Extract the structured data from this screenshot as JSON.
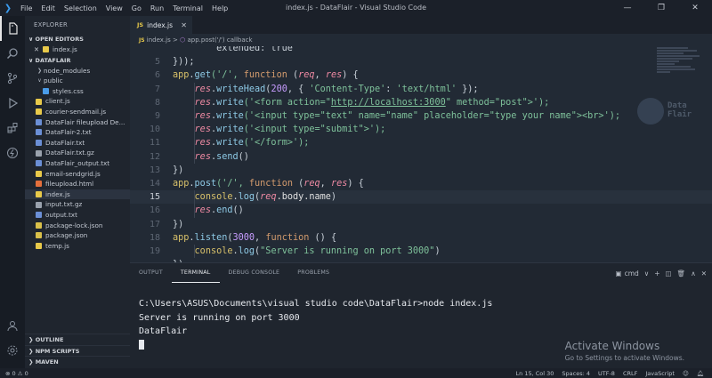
{
  "window": {
    "title": "index.js - DataFlair - Visual Studio Code",
    "menu": [
      "File",
      "Edit",
      "Selection",
      "View",
      "Go",
      "Run",
      "Terminal",
      "Help"
    ],
    "controls": [
      "—",
      "❐",
      "✕"
    ]
  },
  "activity": [
    "files-icon",
    "search-icon",
    "source-control-icon",
    "run-debug-icon",
    "extensions-icon",
    "remote-icon"
  ],
  "sidebar": {
    "header": "EXPLORER",
    "open_editors_label": "OPEN EDITORS",
    "open_editor_file": "index.js",
    "folder_label": "DATAFLAIR",
    "items": [
      {
        "label": "node_modules",
        "type": "folder",
        "indent": 1
      },
      {
        "label": "public",
        "type": "folder-open",
        "indent": 1
      },
      {
        "label": "styles.css",
        "type": "css",
        "indent": 2
      },
      {
        "label": "client.js",
        "type": "js",
        "indent": 1
      },
      {
        "label": "courier-sendmail.js",
        "type": "js",
        "indent": 1
      },
      {
        "label": "DataFlair fileupload De...",
        "type": "txt",
        "indent": 1
      },
      {
        "label": "DataFlair-2.txt",
        "type": "txt",
        "indent": 1
      },
      {
        "label": "DataFlair.txt",
        "type": "txt",
        "indent": 1
      },
      {
        "label": "DataFlair.txt.gz",
        "type": "gz",
        "indent": 1
      },
      {
        "label": "DataFlair_output.txt",
        "type": "txt",
        "indent": 1
      },
      {
        "label": "email-sendgrid.js",
        "type": "js",
        "indent": 1
      },
      {
        "label": "fileupload.html",
        "type": "html",
        "indent": 1
      },
      {
        "label": "index.js",
        "type": "js",
        "indent": 1,
        "selected": true
      },
      {
        "label": "input.txt.gz",
        "type": "gz",
        "indent": 1
      },
      {
        "label": "output.txt",
        "type": "txt",
        "indent": 1
      },
      {
        "label": "package-lock.json",
        "type": "json",
        "indent": 1
      },
      {
        "label": "package.json",
        "type": "json",
        "indent": 1
      },
      {
        "label": "temp.js",
        "type": "js",
        "indent": 1
      }
    ],
    "bottom_sections": [
      "OUTLINE",
      "NPM SCRIPTS",
      "MAVEN"
    ]
  },
  "editor": {
    "tab_label": "index.js",
    "tab_icon": "JS",
    "breadcrumb": {
      "file": "index.js",
      "separator": ">",
      "symbol": "app.post('/') callback"
    },
    "lines": [
      {
        "n": "",
        "tokens": [
          {
            "t": "        extended: true",
            "c": "t-p"
          }
        ],
        "partial": true
      },
      {
        "n": "5",
        "tokens": [
          {
            "t": "}));",
            "c": "t-p"
          }
        ]
      },
      {
        "n": "6",
        "tokens": [
          {
            "t": "app",
            "c": "t-obj"
          },
          {
            "t": ".",
            "c": "t-p"
          },
          {
            "t": "get",
            "c": "t-call"
          },
          {
            "t": "('/', ",
            "c": "t-str"
          },
          {
            "t": "function",
            "c": "t-kw"
          },
          {
            "t": " (",
            "c": "t-p"
          },
          {
            "t": "req",
            "c": "t-var"
          },
          {
            "t": ", ",
            "c": "t-p"
          },
          {
            "t": "res",
            "c": "t-var"
          },
          {
            "t": ") {",
            "c": "t-p"
          }
        ]
      },
      {
        "n": "7",
        "tokens": [
          {
            "t": "    ",
            "c": "t-p"
          },
          {
            "t": "res",
            "c": "t-var"
          },
          {
            "t": ".",
            "c": "t-p"
          },
          {
            "t": "writeHead",
            "c": "t-call"
          },
          {
            "t": "(",
            "c": "t-p"
          },
          {
            "t": "200",
            "c": "t-num"
          },
          {
            "t": ", { ",
            "c": "t-p"
          },
          {
            "t": "'Content-Type'",
            "c": "t-str"
          },
          {
            "t": ": ",
            "c": "t-p"
          },
          {
            "t": "'text/html'",
            "c": "t-str"
          },
          {
            "t": " });",
            "c": "t-p"
          }
        ]
      },
      {
        "n": "8",
        "tokens": [
          {
            "t": "    ",
            "c": "t-p"
          },
          {
            "t": "res",
            "c": "t-var"
          },
          {
            "t": ".",
            "c": "t-p"
          },
          {
            "t": "write",
            "c": "t-call"
          },
          {
            "t": "('<form action=\"",
            "c": "t-str"
          },
          {
            "t": "http://localhost:3000",
            "c": "t-url"
          },
          {
            "t": "\" method=\"post\">');",
            "c": "t-str"
          }
        ]
      },
      {
        "n": "9",
        "tokens": [
          {
            "t": "    ",
            "c": "t-p"
          },
          {
            "t": "res",
            "c": "t-var"
          },
          {
            "t": ".",
            "c": "t-p"
          },
          {
            "t": "write",
            "c": "t-call"
          },
          {
            "t": "('<input type=\"text\" name=\"name\" placeholder=\"type your name\"><br>');",
            "c": "t-str"
          }
        ]
      },
      {
        "n": "10",
        "tokens": [
          {
            "t": "    ",
            "c": "t-p"
          },
          {
            "t": "res",
            "c": "t-var"
          },
          {
            "t": ".",
            "c": "t-p"
          },
          {
            "t": "write",
            "c": "t-call"
          },
          {
            "t": "('<input type=\"submit\">');",
            "c": "t-str"
          }
        ]
      },
      {
        "n": "11",
        "tokens": [
          {
            "t": "    ",
            "c": "t-p"
          },
          {
            "t": "res",
            "c": "t-var"
          },
          {
            "t": ".",
            "c": "t-p"
          },
          {
            "t": "write",
            "c": "t-call"
          },
          {
            "t": "('</form>');",
            "c": "t-str"
          }
        ]
      },
      {
        "n": "12",
        "tokens": [
          {
            "t": "    ",
            "c": "t-p"
          },
          {
            "t": "res",
            "c": "t-var"
          },
          {
            "t": ".",
            "c": "t-p"
          },
          {
            "t": "send",
            "c": "t-call"
          },
          {
            "t": "()",
            "c": "t-p"
          }
        ]
      },
      {
        "n": "13",
        "tokens": [
          {
            "t": "})",
            "c": "t-p"
          }
        ]
      },
      {
        "n": "14",
        "tokens": [
          {
            "t": "app",
            "c": "t-obj"
          },
          {
            "t": ".",
            "c": "t-p"
          },
          {
            "t": "post",
            "c": "t-call"
          },
          {
            "t": "('/', ",
            "c": "t-str"
          },
          {
            "t": "function",
            "c": "t-kw"
          },
          {
            "t": " (",
            "c": "t-p"
          },
          {
            "t": "req",
            "c": "t-var"
          },
          {
            "t": ", ",
            "c": "t-p"
          },
          {
            "t": "res",
            "c": "t-var"
          },
          {
            "t": ") {",
            "c": "t-p"
          }
        ]
      },
      {
        "n": "15",
        "current": true,
        "tokens": [
          {
            "t": "    ",
            "c": "t-p"
          },
          {
            "t": "console",
            "c": "t-obj"
          },
          {
            "t": ".",
            "c": "t-p"
          },
          {
            "t": "log",
            "c": "t-call"
          },
          {
            "t": "(",
            "c": "t-p"
          },
          {
            "t": "req",
            "c": "t-var"
          },
          {
            "t": ".body.name",
            "c": "t-prop"
          },
          {
            "t": ")",
            "c": "t-p"
          }
        ]
      },
      {
        "n": "16",
        "tokens": [
          {
            "t": "    ",
            "c": "t-p"
          },
          {
            "t": "res",
            "c": "t-var"
          },
          {
            "t": ".",
            "c": "t-p"
          },
          {
            "t": "end",
            "c": "t-call"
          },
          {
            "t": "()",
            "c": "t-p"
          }
        ]
      },
      {
        "n": "17",
        "tokens": [
          {
            "t": "})",
            "c": "t-p"
          }
        ]
      },
      {
        "n": "18",
        "tokens": [
          {
            "t": "app",
            "c": "t-obj"
          },
          {
            "t": ".",
            "c": "t-p"
          },
          {
            "t": "listen",
            "c": "t-call"
          },
          {
            "t": "(",
            "c": "t-p"
          },
          {
            "t": "3000",
            "c": "t-num"
          },
          {
            "t": ", ",
            "c": "t-p"
          },
          {
            "t": "function",
            "c": "t-kw"
          },
          {
            "t": " () {",
            "c": "t-p"
          }
        ]
      },
      {
        "n": "19",
        "tokens": [
          {
            "t": "    ",
            "c": "t-p"
          },
          {
            "t": "console",
            "c": "t-obj"
          },
          {
            "t": ".",
            "c": "t-p"
          },
          {
            "t": "log",
            "c": "t-call"
          },
          {
            "t": "(",
            "c": "t-p"
          },
          {
            "t": "\"Server is running on port 3000\"",
            "c": "t-str"
          },
          {
            "t": ")",
            "c": "t-p"
          }
        ]
      },
      {
        "n": "",
        "tokens": [
          {
            "t": "})",
            "c": "t-p"
          }
        ],
        "partial": true
      }
    ]
  },
  "panel": {
    "tabs": [
      "OUTPUT",
      "TERMINAL",
      "DEBUG CONSOLE",
      "PROBLEMS"
    ],
    "active_tab": "TERMINAL",
    "terminal_type": "cmd",
    "terminal_lines": [
      "C:\\Users\\ASUS\\Documents\\visual studio code\\DataFlair>node index.js",
      "Server is running on port 3000",
      "DataFlair"
    ],
    "activate_title": "Activate Windows",
    "activate_sub": "Go to Settings to activate Windows."
  },
  "statusbar": {
    "errors": "⊗ 0 ⚠ 0",
    "position": "Ln 15, Col 30",
    "spaces": "Spaces: 4",
    "encoding": "UTF-8",
    "eol": "CRLF",
    "language": "JavaScript"
  }
}
